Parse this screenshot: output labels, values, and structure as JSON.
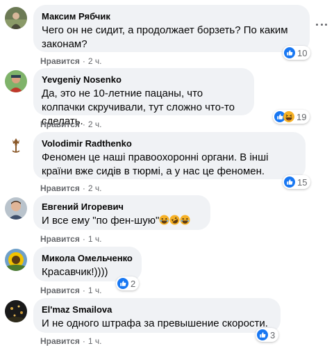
{
  "comments": [
    {
      "author": "Максим Рябчик",
      "text": "Чего он не сидит, а продолжает борзеть? По каким законам?",
      "like_label": "Нравится",
      "time": "2 ч.",
      "reactions": [
        "like"
      ],
      "reaction_count": "10"
    },
    {
      "author": "Yevgeniy Nosenko",
      "text": "Да, это не 10-летние пацаны, что колпачки скручивали, тут сложно что-то сделать.",
      "like_label": "Нравится",
      "time": "2 ч.",
      "reactions": [
        "like",
        "haha"
      ],
      "reaction_count": "19"
    },
    {
      "author": "Volodimir Radthenko",
      "text": "Феномен це наші правоохоронні органи. В інші країни вже сидів в тюрмі, а у нас це феномен.",
      "like_label": "Нравится",
      "time": "2 ч.",
      "reactions": [
        "like"
      ],
      "reaction_count": "15"
    },
    {
      "author": "Евгений Игоревич",
      "text": "И все ему \"по фен-шую\"",
      "text_emojis": [
        "laughing-emoji",
        "rolling-laughing-emoji",
        "laughing-emoji"
      ],
      "like_label": "Нравится",
      "time": "1 ч."
    },
    {
      "author": "Микола Омельченко",
      "text": "Красавчик!))))",
      "like_label": "Нравится",
      "time": "1 ч.",
      "reactions": [
        "like"
      ],
      "reaction_count": "2"
    },
    {
      "author": "El'maz Smailova",
      "text": "И не одного штрафа за превышение скорости.",
      "like_label": "Нравится",
      "time": "1 ч.",
      "reactions": [
        "like"
      ],
      "reaction_count": "3"
    }
  ],
  "colors": {
    "like_blue": "#1877f2",
    "bubble_bg": "#f0f2f5",
    "meta_gray": "#65676b",
    "haha_yellow": "#f7b125"
  }
}
